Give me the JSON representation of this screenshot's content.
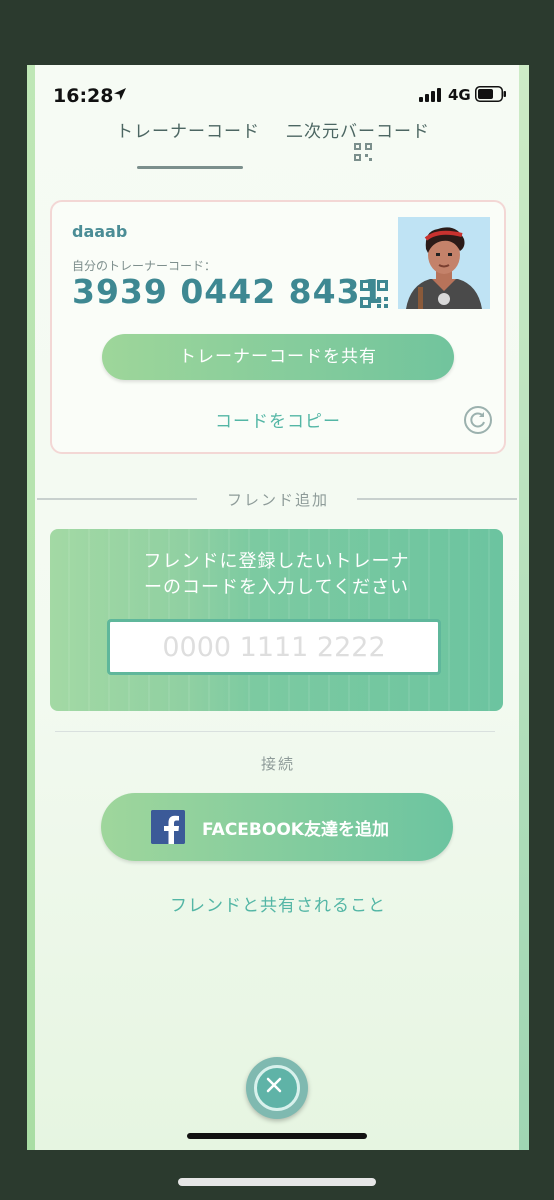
{
  "status_bar": {
    "time": "16:28",
    "network": "4G"
  },
  "tabs": [
    {
      "label": "トレーナーコード",
      "selected": true
    },
    {
      "label": "二次元バーコード",
      "selected": false
    }
  ],
  "trainer_card": {
    "username": "daaab",
    "code_label": "自分のトレーナーコード：",
    "code": "3939 0442 8431",
    "share_button": "トレーナーコードを共有",
    "copy_link": "コードをコピー"
  },
  "friend_add": {
    "section_title": "フレンド追加",
    "instruction_line1": "フレンドに登録したいトレーナ",
    "instruction_line2": "ーのコードを入力してください",
    "input_placeholder": "0000 1111 2222",
    "input_value": ""
  },
  "connect": {
    "section_title": "接続",
    "facebook_button": "FACEBOOK友達を追加",
    "shared_link": "フレンドと共有されること"
  },
  "colors": {
    "accent_green": "#71c49d",
    "code_teal": "#3e8892",
    "link_teal": "#53b6a5",
    "facebook_blue": "#3b5a98"
  },
  "icons": [
    "location-arrow-icon",
    "signal-icon",
    "battery-icon",
    "qr-code-icon",
    "refresh-icon",
    "facebook-icon",
    "close-icon"
  ]
}
